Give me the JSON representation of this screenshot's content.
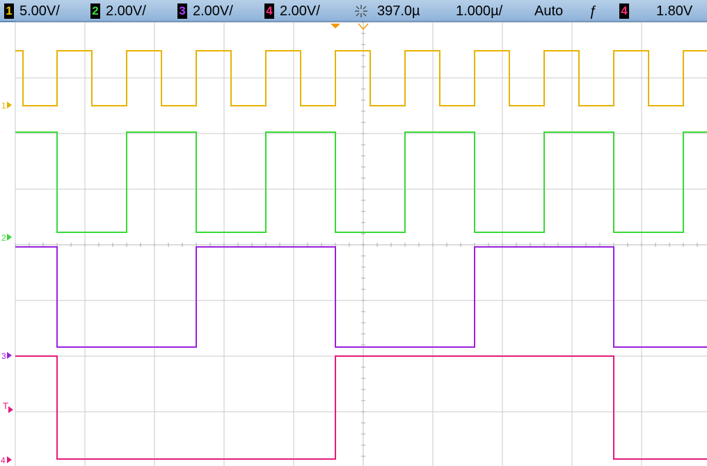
{
  "status": {
    "channels": [
      {
        "num": "1",
        "scale": "5.00V/",
        "color": "#f2c400"
      },
      {
        "num": "2",
        "scale": "2.00V/",
        "color": "#39e039"
      },
      {
        "num": "3",
        "scale": "2.00V/",
        "color": "#b23cff"
      },
      {
        "num": "4",
        "scale": "2.00V/",
        "color": "#ff2d7a"
      }
    ],
    "delay": "397.0µ",
    "timebase": "1.000",
    "timebase_unit": "µ/",
    "mode": "Auto",
    "trigger_source": "4",
    "trigger_level": "1.80V"
  },
  "markers": {
    "ch1": "1",
    "ch2": "2",
    "ch3": "3",
    "ch4": "4",
    "trigger": "T"
  },
  "colors": {
    "ch1": "#e8b200",
    "ch2": "#36d936",
    "ch3": "#9b1fe0",
    "ch4": "#e5197a",
    "grid": "#c8c8c8",
    "delay_marker": "#f29a00"
  },
  "waveforms": {
    "ch1": {
      "period": 1.0,
      "duty_high_start": 0.6,
      "high_volts": 5,
      "low_volts": 0
    },
    "ch2": {
      "period": 2.0,
      "volts_high": 3.3,
      "volts_low": 0
    },
    "ch3": {
      "period": 4.0
    },
    "ch4": {
      "period": 8.0
    }
  }
}
